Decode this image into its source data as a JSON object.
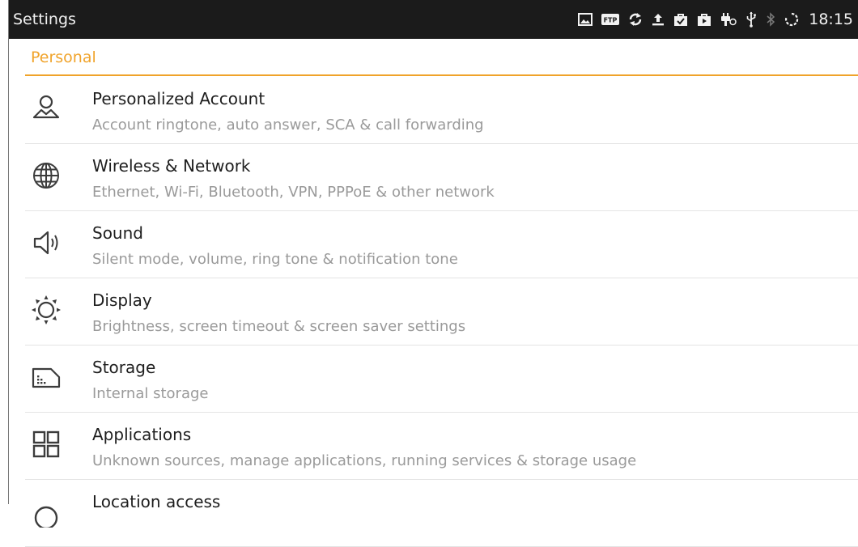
{
  "status_bar": {
    "title": "Settings",
    "time": "18:15",
    "icons": [
      "image-icon",
      "ftp-icon",
      "sync-icon",
      "upload-icon",
      "bag-check-icon",
      "bag-play-icon",
      "power-plug-icon",
      "usb-icon",
      "bluetooth-icon",
      "loading-icon"
    ],
    "ftp_label": "FTP"
  },
  "section": {
    "title": "Personal",
    "accent_color": "#f0a32a"
  },
  "items": [
    {
      "title": "Personalized Account",
      "subtitle": "Account ringtone, auto answer, SCA & call forwarding",
      "icon": "account-icon"
    },
    {
      "title": "Wireless & Network",
      "subtitle": "Ethernet, Wi-Fi, Bluetooth, VPN, PPPoE & other network",
      "icon": "globe-icon"
    },
    {
      "title": "Sound",
      "subtitle": "Silent mode, volume, ring tone & notification tone",
      "icon": "speaker-icon"
    },
    {
      "title": "Display",
      "subtitle": "Brightness, screen timeout & screen saver settings",
      "icon": "brightness-icon"
    },
    {
      "title": "Storage",
      "subtitle": "Internal storage",
      "icon": "sd-card-icon"
    },
    {
      "title": "Applications",
      "subtitle": "Unknown sources, manage applications, running services & storage usage",
      "icon": "apps-grid-icon"
    },
    {
      "title": "Location access",
      "subtitle": "",
      "icon": "location-icon"
    }
  ]
}
